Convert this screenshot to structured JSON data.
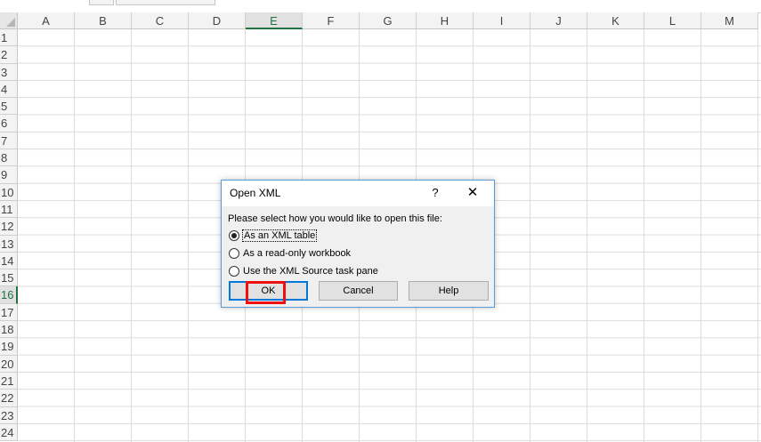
{
  "columns": [
    "A",
    "B",
    "C",
    "D",
    "E",
    "F",
    "G",
    "H",
    "I",
    "J",
    "K",
    "L",
    "M"
  ],
  "selected_column": "E",
  "rows": [
    "1",
    "2",
    "3",
    "4",
    "5",
    "6",
    "7",
    "8",
    "9",
    "10",
    "11",
    "12",
    "13",
    "14",
    "15",
    "16",
    "17",
    "18",
    "19",
    "20",
    "21",
    "22",
    "23",
    "24"
  ],
  "selected_row": "16",
  "dialog": {
    "title": "Open XML",
    "help_label": "?",
    "close_label": "✕",
    "prompt": "Please select how you would like to open this file:",
    "options": [
      {
        "label": "As an XML table",
        "checked": true
      },
      {
        "label": "As a read-only workbook",
        "checked": false
      },
      {
        "label": "Use the XML Source task pane",
        "checked": false
      }
    ],
    "ok_label": "OK",
    "cancel_label": "Cancel",
    "help_button_label": "Help"
  },
  "colors": {
    "selected_header": "#217346",
    "focus_border": "#0078d7",
    "annotation": "#ee1111"
  }
}
